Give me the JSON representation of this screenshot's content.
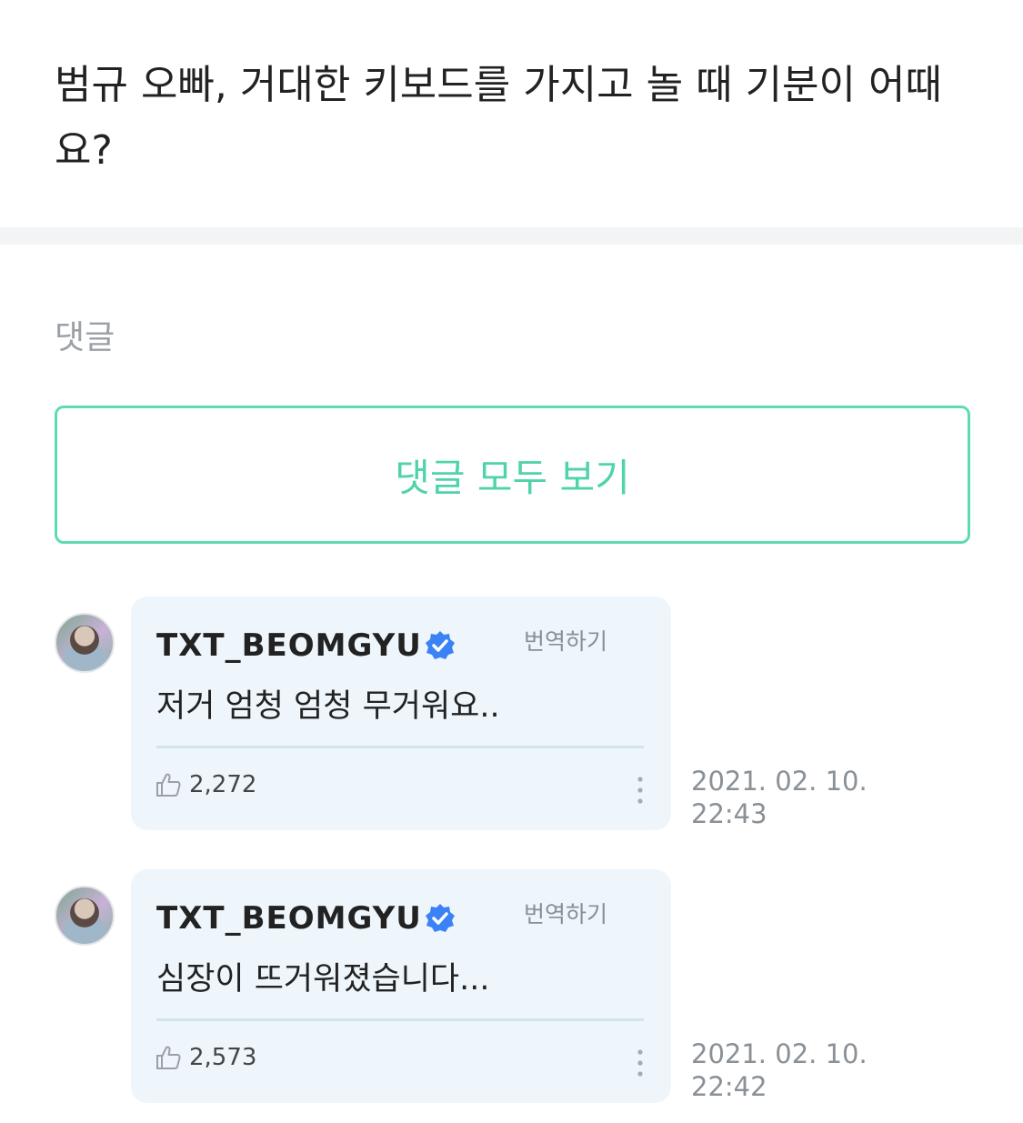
{
  "post": {
    "question": "범규 오빠, 거대한 키보드를 가지고 놀 때 기분이 어때요?"
  },
  "comments_section": {
    "title": "댓글",
    "view_all_label": "댓글 모두 보기"
  },
  "comments": [
    {
      "username": "TXT_BEOMGYU",
      "verified": true,
      "translate_label": "번역하기",
      "text": "저거 엄청 엄청 무거워요..",
      "likes": "2,272",
      "date": "2021. 02. 10.",
      "time": "22:43"
    },
    {
      "username": "TXT_BEOMGYU",
      "verified": true,
      "translate_label": "번역하기",
      "text": "심장이 뜨거워졌습니다...",
      "likes": "2,573",
      "date": "2021. 02. 10.",
      "time": "22:42"
    }
  ],
  "colors": {
    "accent": "#4fd3ab",
    "bubble": "#eef6fc",
    "verified": "#3b82f6"
  }
}
